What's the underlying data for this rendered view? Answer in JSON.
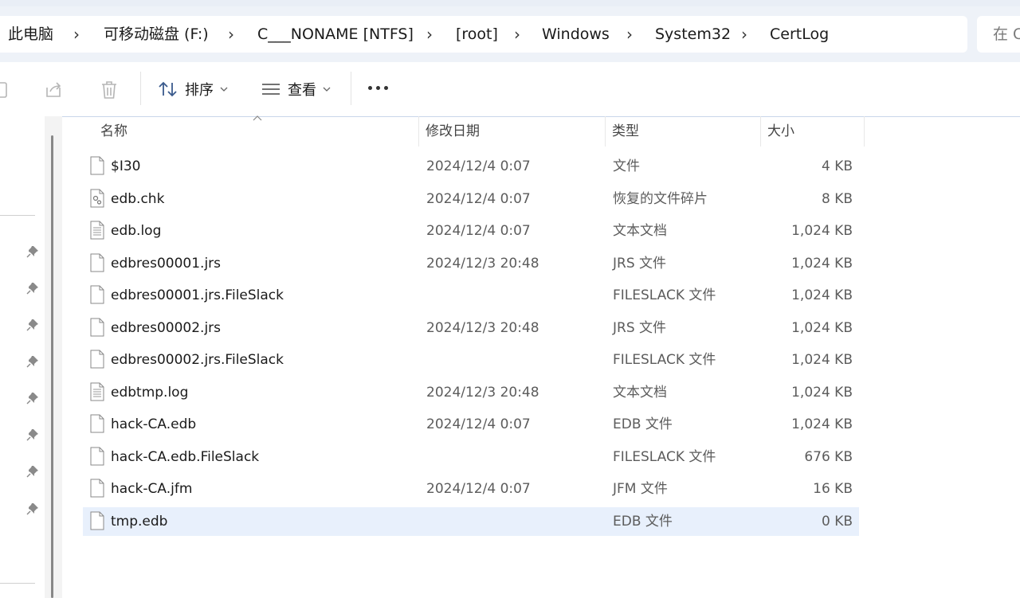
{
  "breadcrumb": {
    "items": [
      "此电脑",
      "可移动磁盘 (F:)",
      "C___NONAME [NTFS]",
      "[root]",
      "Windows",
      "System32",
      "CertLog"
    ],
    "separator": "›"
  },
  "search": {
    "placeholder": "在 C"
  },
  "toolbar": {
    "sort_label": "排序",
    "view_label": "查看",
    "more_label": "..."
  },
  "columns": {
    "name": "名称",
    "date": "修改日期",
    "type": "类型",
    "size": "大小"
  },
  "files": [
    {
      "name": "$I30",
      "date": "2024/12/4 0:07",
      "type": "文件",
      "size": "4 KB",
      "icon": "blank-file-icon"
    },
    {
      "name": "edb.chk",
      "date": "2024/12/4 0:07",
      "type": "恢复的文件碎片",
      "size": "8 KB",
      "icon": "system-file-icon"
    },
    {
      "name": "edb.log",
      "date": "2024/12/4 0:07",
      "type": "文本文档",
      "size": "1,024 KB",
      "icon": "text-file-icon"
    },
    {
      "name": "edbres00001.jrs",
      "date": "2024/12/3 20:48",
      "type": "JRS 文件",
      "size": "1,024 KB",
      "icon": "blank-file-icon"
    },
    {
      "name": "edbres00001.jrs.FileSlack",
      "date": "",
      "type": "FILESLACK 文件",
      "size": "1,024 KB",
      "icon": "blank-file-icon"
    },
    {
      "name": "edbres00002.jrs",
      "date": "2024/12/3 20:48",
      "type": "JRS 文件",
      "size": "1,024 KB",
      "icon": "blank-file-icon"
    },
    {
      "name": "edbres00002.jrs.FileSlack",
      "date": "",
      "type": "FILESLACK 文件",
      "size": "1,024 KB",
      "icon": "blank-file-icon"
    },
    {
      "name": "edbtmp.log",
      "date": "2024/12/3 20:48",
      "type": "文本文档",
      "size": "1,024 KB",
      "icon": "text-file-icon"
    },
    {
      "name": "hack-CA.edb",
      "date": "2024/12/4 0:07",
      "type": "EDB 文件",
      "size": "1,024 KB",
      "icon": "blank-file-icon"
    },
    {
      "name": "hack-CA.edb.FileSlack",
      "date": "",
      "type": "FILESLACK 文件",
      "size": "676 KB",
      "icon": "blank-file-icon"
    },
    {
      "name": "hack-CA.jfm",
      "date": "2024/12/4 0:07",
      "type": "JFM 文件",
      "size": "16 KB",
      "icon": "blank-file-icon"
    },
    {
      "name": "tmp.edb",
      "date": "",
      "type": "EDB 文件",
      "size": "0 KB",
      "icon": "blank-file-icon",
      "selected": true
    }
  ],
  "colors": {
    "selection": "#e8f0fc",
    "address_bg": "#eef2f8",
    "toolbar_border": "#c9d6ea"
  }
}
